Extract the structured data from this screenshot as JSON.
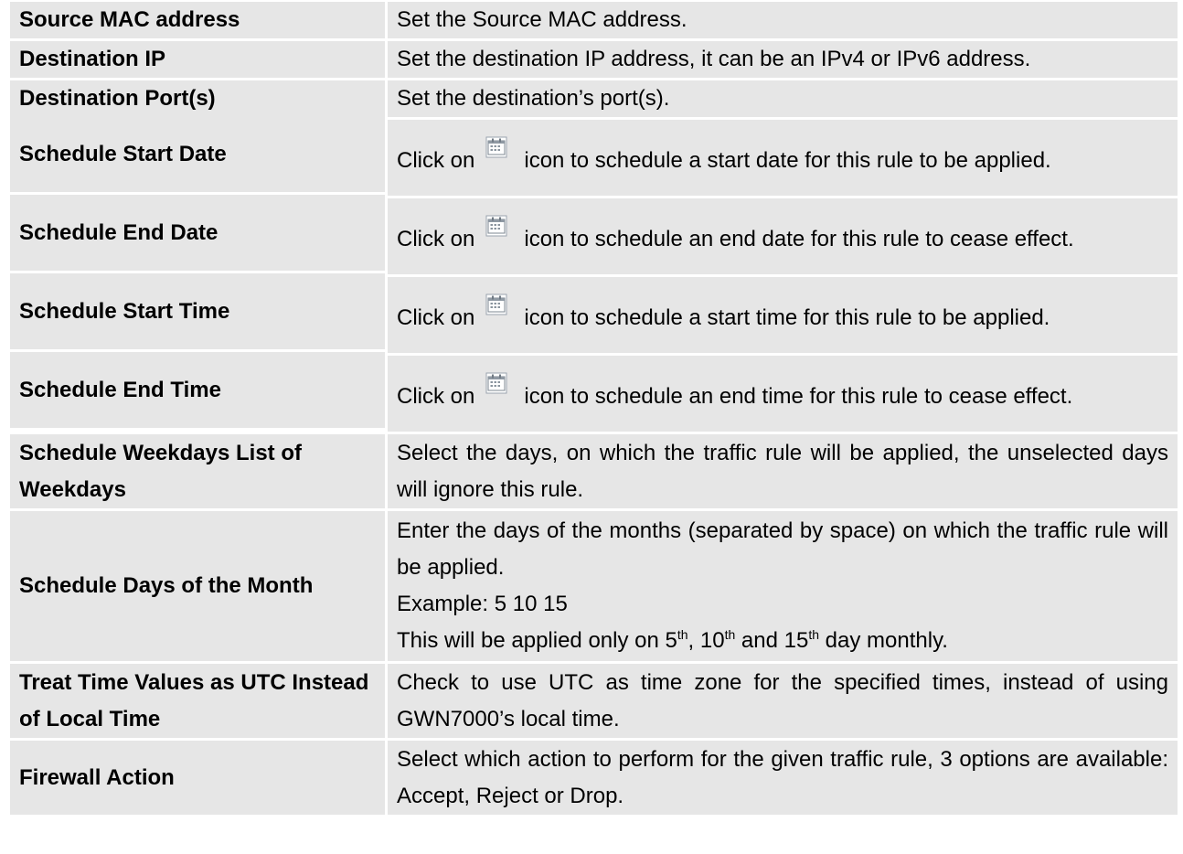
{
  "rows": [
    {
      "label": "Source MAC address",
      "desc": "Set the Source MAC address."
    },
    {
      "label": "Destination IP",
      "desc": "Set the destination IP address, it can be an IPv4 or IPv6 address."
    },
    {
      "label": "Destination Port(s)",
      "desc": "Set the destination’s port(s)."
    },
    {
      "label": "Schedule Start Date",
      "pre": "Click on",
      "post": "icon to schedule a start date for this rule to be applied."
    },
    {
      "label": "Schedule End Date",
      "pre": "Click on",
      "post": "icon to schedule an end date for this rule to cease effect."
    },
    {
      "label": "Schedule Start Time",
      "pre": "Click on",
      "post": "icon to schedule a start time for this rule to be applied."
    },
    {
      "label": "Schedule End Time",
      "pre": "Click on",
      "post": "icon to schedule an end time for this rule to cease effect."
    },
    {
      "label": "Schedule Weekdays List of Weekdays",
      "desc": "Select the days, on which the traffic rule will be applied, the unselected days will ignore this rule."
    },
    {
      "label": "Schedule Days of the Month",
      "line1": "Enter the days of the months (separated by space) on which the traffic rule will be applied.",
      "example": "Example: 5 10 15",
      "note": {
        "a": "This will be applied only on 5",
        "sup1": "th",
        "b": ", 10",
        "sup2": "th",
        "c": " and 15",
        "sup3": "th",
        "d": " day monthly."
      }
    },
    {
      "label": "Treat Time Values as UTC Instead of Local Time",
      "desc": "Check to use UTC as time zone for the specified times, instead of using GWN7000’s local time."
    },
    {
      "label": "Firewall Action",
      "desc": "Select which action to perform for the given traffic rule, 3 options are available: Accept, Reject or Drop."
    }
  ],
  "icons": {
    "calendar": "calendar-icon"
  }
}
